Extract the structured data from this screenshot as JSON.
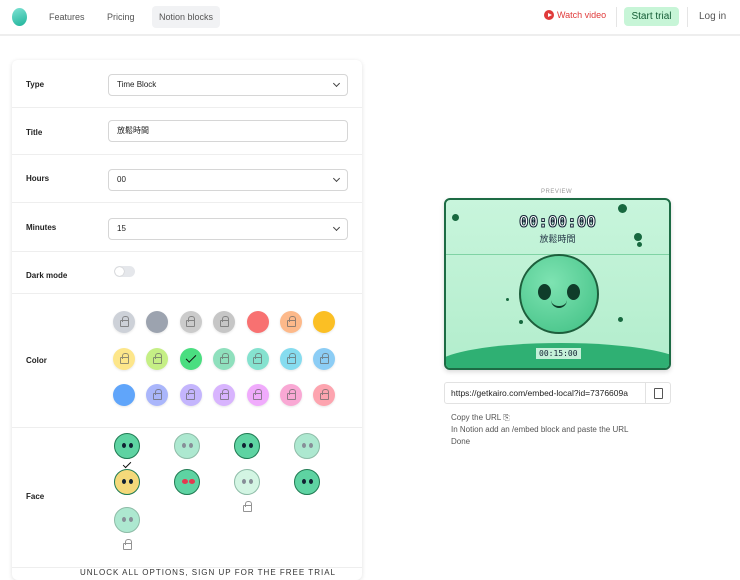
{
  "nav": {
    "features": "Features",
    "pricing": "Pricing",
    "notion_blocks": "Notion blocks",
    "watch_video": "Watch video",
    "start_trial": "Start trial",
    "login": "Log in"
  },
  "form": {
    "type": {
      "label": "Type",
      "value": "Time Block"
    },
    "title": {
      "label": "Title",
      "value": "放鬆時間"
    },
    "hours": {
      "label": "Hours",
      "value": "00"
    },
    "minutes": {
      "label": "Minutes",
      "value": "15"
    },
    "dark_mode": {
      "label": "Dark mode",
      "on": false
    },
    "color": {
      "label": "Color",
      "swatches": [
        {
          "hex": "#cdd1d8",
          "locked": true
        },
        {
          "hex": "#9ca3af",
          "locked": false
        },
        {
          "hex": "#cbcbcb",
          "locked": true
        },
        {
          "hex": "#c6c6c6",
          "locked": true
        },
        {
          "hex": "#f87171",
          "locked": false
        },
        {
          "hex": "#fdb98a",
          "locked": true
        },
        {
          "hex": "#fbbf24",
          "locked": false
        },
        {
          "hex": "#fde68a",
          "locked": true
        },
        {
          "hex": "#c5ef85",
          "locked": true
        },
        {
          "hex": "#4ade80",
          "locked": false,
          "selected": true
        },
        {
          "hex": "#8fe0bd",
          "locked": true
        },
        {
          "hex": "#85e2cf",
          "locked": true
        },
        {
          "hex": "#86dcef",
          "locked": true
        },
        {
          "hex": "#8ccdf5",
          "locked": true
        },
        {
          "hex": "#60a5fa",
          "locked": false
        },
        {
          "hex": "#aab6fb",
          "locked": true
        },
        {
          "hex": "#c4b5fd",
          "locked": true
        },
        {
          "hex": "#d8b4fe",
          "locked": true
        },
        {
          "hex": "#f0abfc",
          "locked": true
        },
        {
          "hex": "#f9a8d4",
          "locked": true
        },
        {
          "hex": "#fda4af",
          "locked": true
        }
      ]
    },
    "face": {
      "label": "Face",
      "options": [
        {
          "name": "smile",
          "locked": false,
          "selected": true
        },
        {
          "name": "cat",
          "locked": true
        },
        {
          "name": "bear",
          "locked": false
        },
        {
          "name": "owl",
          "locked": true
        },
        {
          "name": "frog-hood",
          "locked": true
        },
        {
          "name": "heart-eyes",
          "locked": false
        },
        {
          "name": "tongue",
          "locked": true
        },
        {
          "name": "sad",
          "locked": true
        },
        {
          "name": "turtle",
          "locked": true
        }
      ]
    }
  },
  "unlock_text": "UNLOCK ALL OPTIONS, SIGN UP FOR THE FREE TRIAL",
  "preview": {
    "label": "PREVIEW",
    "clock": "00:00:00",
    "title": "放鬆時間",
    "countdown": "00:15:00"
  },
  "embed": {
    "url": "https://getkairo.com/embed-local?id=7376609a",
    "step1": "Copy the URL",
    "step2": "In Notion add an /embed block and paste the URL",
    "step3": "Done"
  }
}
